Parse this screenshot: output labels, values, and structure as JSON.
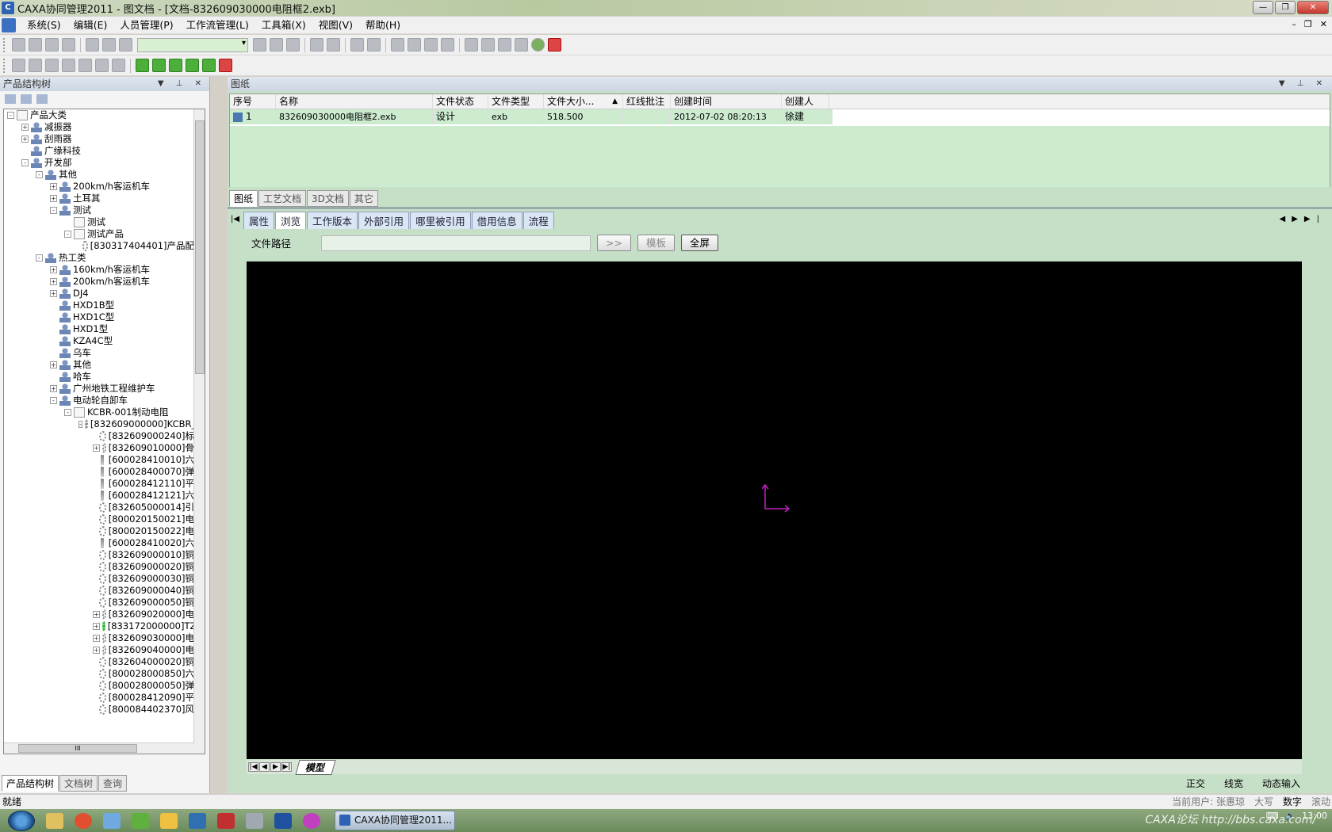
{
  "window": {
    "title": "CAXA协同管理2011 - 图文档 - [文档-832609030000电阻框2.exb]"
  },
  "menu": [
    {
      "label": "系统(S)"
    },
    {
      "label": "编辑(E)"
    },
    {
      "label": "人员管理(P)"
    },
    {
      "label": "工作流管理(L)"
    },
    {
      "label": "工具箱(X)"
    },
    {
      "label": "视图(V)"
    },
    {
      "label": "帮助(H)"
    }
  ],
  "left_panel": {
    "title": "产品结构树",
    "tree": [
      {
        "label": "产品大类",
        "level": 0,
        "exp": "-",
        "icon": "folder-icon"
      },
      {
        "label": "减振器",
        "level": 1,
        "exp": "+",
        "icon": "category-icon"
      },
      {
        "label": "刮雨器",
        "level": 1,
        "exp": "+",
        "icon": "category-icon"
      },
      {
        "label": "广缘科技",
        "level": 1,
        "exp": "",
        "icon": "category-icon"
      },
      {
        "label": "开发部",
        "level": 1,
        "exp": "-",
        "icon": "category-icon"
      },
      {
        "label": "其他",
        "level": 2,
        "exp": "-",
        "icon": "category-icon"
      },
      {
        "label": "200km/h客运机车",
        "level": 3,
        "exp": "+",
        "icon": "category-icon"
      },
      {
        "label": "土耳其",
        "level": 3,
        "exp": "+",
        "icon": "category-icon"
      },
      {
        "label": "测试",
        "level": 3,
        "exp": "-",
        "icon": "category-icon"
      },
      {
        "label": "测试",
        "level": 4,
        "exp": "",
        "icon": "product-icon"
      },
      {
        "label": "测试产品",
        "level": 4,
        "exp": "-",
        "icon": "product-icon"
      },
      {
        "label": "[830317404401]产品配",
        "level": 5,
        "exp": "",
        "icon": "assembly-icon"
      },
      {
        "label": "热工类",
        "level": 2,
        "exp": "-",
        "icon": "category-icon"
      },
      {
        "label": "160km/h客运机车",
        "level": 3,
        "exp": "+",
        "icon": "category-icon"
      },
      {
        "label": "200km/h客运机车",
        "level": 3,
        "exp": "+",
        "icon": "category-icon"
      },
      {
        "label": "DJ4",
        "level": 3,
        "exp": "+",
        "icon": "category-icon"
      },
      {
        "label": "HXD1B型",
        "level": 3,
        "exp": "",
        "icon": "category-icon"
      },
      {
        "label": "HXD1C型",
        "level": 3,
        "exp": "",
        "icon": "category-icon"
      },
      {
        "label": "HXD1型",
        "level": 3,
        "exp": "",
        "icon": "category-icon"
      },
      {
        "label": "KZA4C型",
        "level": 3,
        "exp": "",
        "icon": "category-icon"
      },
      {
        "label": "乌车",
        "level": 3,
        "exp": "",
        "icon": "category-icon"
      },
      {
        "label": "其他",
        "level": 3,
        "exp": "+",
        "icon": "category-icon"
      },
      {
        "label": "哈车",
        "level": 3,
        "exp": "",
        "icon": "category-icon"
      },
      {
        "label": "广州地铁工程维护车",
        "level": 3,
        "exp": "+",
        "icon": "category-icon"
      },
      {
        "label": "电动轮自卸车",
        "level": 3,
        "exp": "-",
        "icon": "category-icon"
      },
      {
        "label": "KCBR-001制动电阻",
        "level": 4,
        "exp": "-",
        "icon": "product-icon"
      },
      {
        "label": "[832609000000]KCBR_0",
        "level": 5,
        "exp": "-",
        "icon": "assembly-icon"
      },
      {
        "label": "[832609000240]标",
        "level": 6,
        "exp": "",
        "icon": "part-icon"
      },
      {
        "label": "[832609010000]骨",
        "level": 6,
        "exp": "+",
        "icon": "part-icon"
      },
      {
        "label": "[600028410010]六",
        "level": 6,
        "exp": "",
        "icon": "bolt-icon"
      },
      {
        "label": "[600028400070]弹",
        "level": 6,
        "exp": "",
        "icon": "bolt-icon"
      },
      {
        "label": "[600028412110]平",
        "level": 6,
        "exp": "",
        "icon": "bolt-icon"
      },
      {
        "label": "[600028412121]六",
        "level": 6,
        "exp": "",
        "icon": "bolt-icon"
      },
      {
        "label": "[832605000014]引",
        "level": 6,
        "exp": "",
        "icon": "part-icon"
      },
      {
        "label": "[800020150021]电",
        "level": 6,
        "exp": "",
        "icon": "part-icon"
      },
      {
        "label": "[800020150022]电",
        "level": 6,
        "exp": "",
        "icon": "part-icon"
      },
      {
        "label": "[600028410020]六",
        "level": 6,
        "exp": "",
        "icon": "bolt-icon"
      },
      {
        "label": "[832609000010]铜",
        "level": 6,
        "exp": "",
        "icon": "part-icon"
      },
      {
        "label": "[832609000020]铜",
        "level": 6,
        "exp": "",
        "icon": "part-icon"
      },
      {
        "label": "[832609000030]铜",
        "level": 6,
        "exp": "",
        "icon": "part-icon"
      },
      {
        "label": "[832609000040]铜",
        "level": 6,
        "exp": "",
        "icon": "part-icon"
      },
      {
        "label": "[832609000050]铜",
        "level": 6,
        "exp": "",
        "icon": "part-icon"
      },
      {
        "label": "[832609020000]电",
        "level": 6,
        "exp": "+",
        "icon": "part-icon"
      },
      {
        "label": "[833172000000]TZ",
        "level": 6,
        "exp": "+",
        "icon": "part-green-icon"
      },
      {
        "label": "[832609030000]电",
        "level": 6,
        "exp": "+",
        "icon": "part-icon"
      },
      {
        "label": "[832609040000]电",
        "level": 6,
        "exp": "+",
        "icon": "part-icon"
      },
      {
        "label": "[832604000020]铜",
        "level": 6,
        "exp": "",
        "icon": "part-icon"
      },
      {
        "label": "[800028000850]六",
        "level": 6,
        "exp": "",
        "icon": "part-icon"
      },
      {
        "label": "[800028000050]弹",
        "level": 6,
        "exp": "",
        "icon": "part-icon"
      },
      {
        "label": "[800028412090]平",
        "level": 6,
        "exp": "",
        "icon": "part-icon"
      },
      {
        "label": "[800084402370]风",
        "level": 6,
        "exp": "",
        "icon": "part-icon"
      }
    ],
    "hscroll_label": "III",
    "tabs": [
      "产品结构树",
      "文档树",
      "查询"
    ]
  },
  "right_panel": {
    "title": "图纸",
    "grid": {
      "headers": [
        "序号",
        "名称",
        "文件状态",
        "文件类型",
        "文件大小...",
        "红线批注",
        "创建时间",
        "创建人"
      ],
      "sort_indicator": "▲",
      "rows": [
        [
          "1",
          "832609030000电阻框2.exb",
          "设计",
          "exb",
          "518.500",
          "",
          "2012-07-02 08:20:13",
          "徐建"
        ]
      ]
    },
    "doc_tabs": [
      "图纸",
      "工艺文档",
      "3D文档",
      "其它"
    ],
    "sub_tabs": [
      "属性",
      "浏览",
      "工作版本",
      "外部引用",
      "哪里被引用",
      "借用信息",
      "流程"
    ],
    "active_sub_tab": "浏览",
    "path_label": "文件路径",
    "path_value": "",
    "go_label": ">>",
    "template_label": "模板",
    "fullscreen_label": "全屏",
    "model_tab": "模型",
    "view_status": [
      "正交",
      "线宽",
      "动态输入"
    ]
  },
  "statusbar": {
    "left": "就绪",
    "user": "当前用户: 张惠琼",
    "caps": "大写",
    "num": "数字",
    "scroll": "滚动"
  },
  "taskbar": {
    "task_label": "CAXA协同管理2011...",
    "watermark": "CAXA论坛 http://bbs.caxa.com/",
    "clock": "13:00"
  },
  "colors": {
    "panel_bg": "#c6e0c8",
    "row_bg": "#ccebcf",
    "axis": "#c020c0"
  }
}
